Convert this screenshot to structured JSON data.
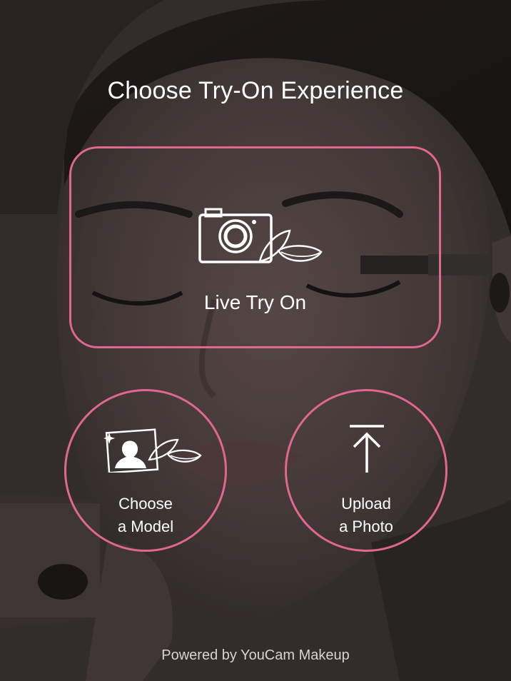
{
  "screen": {
    "title": "Choose Try-On Experience",
    "footer": "Powered by YouCam Makeup"
  },
  "options": {
    "live": {
      "label": "Live Try On",
      "icon": "camera-lens-icon"
    },
    "model": {
      "label_line1": "Choose",
      "label_line2": "a Model",
      "icon": "model-portrait-lens-icon"
    },
    "upload": {
      "label_line1": "Upload",
      "label_line2": "a Photo",
      "icon": "upload-arrow-icon"
    }
  },
  "colors": {
    "accent": "#e0678e",
    "text": "#ffffff",
    "footer_text": "#d8d2d0"
  }
}
